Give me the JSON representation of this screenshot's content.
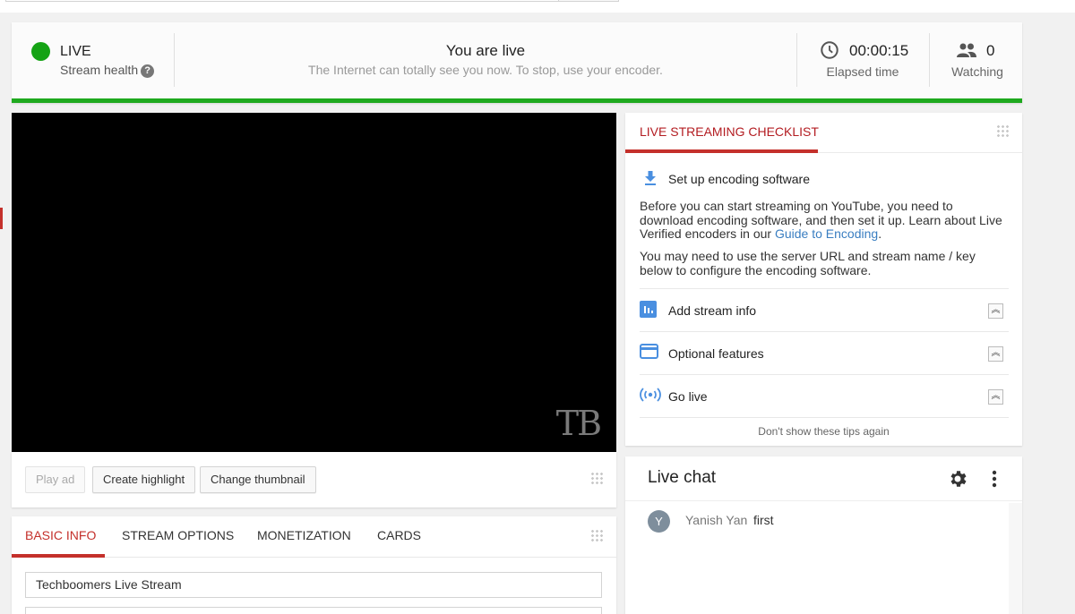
{
  "status": {
    "live_label": "LIVE",
    "health_label": "Stream health",
    "title": "You are live",
    "subtitle": "The Internet can totally see you now. To stop, use your encoder.",
    "elapsed_value": "00:00:15",
    "elapsed_label": "Elapsed time",
    "watching_value": "0",
    "watching_label": "Watching",
    "health_color": "#15a315",
    "accent_color": "#c4302b"
  },
  "video": {
    "watermark": "TB"
  },
  "actions": {
    "play_ad": "Play ad",
    "create_highlight": "Create highlight",
    "change_thumbnail": "Change thumbnail"
  },
  "info": {
    "tabs": [
      {
        "label": "BASIC INFO",
        "active": true
      },
      {
        "label": "STREAM OPTIONS",
        "active": false
      },
      {
        "label": "MONETIZATION",
        "active": false
      },
      {
        "label": "CARDS",
        "active": false
      }
    ],
    "title_value": "Techboomers Live Stream"
  },
  "checklist": {
    "title": "LIVE STREAMING CHECKLIST",
    "main_step": {
      "title": "Set up encoding software",
      "para1_text": "Before you can start streaming on YouTube, you need to download encoding software, and then set it up. Learn about Live Verified encoders in our ",
      "para1_link": "Guide to Encoding",
      "para1_end": ".",
      "para2": "You may need to use the server URL and stream name / key below to configure the encoding software."
    },
    "steps": [
      {
        "label": "Add stream info",
        "icon": "bar-chart-icon"
      },
      {
        "label": "Optional features",
        "icon": "card-icon"
      },
      {
        "label": "Go live",
        "icon": "broadcast-icon"
      }
    ],
    "dont_show": "Don't show these tips again"
  },
  "chat": {
    "title": "Live chat",
    "messages": [
      {
        "avatar_letter": "Y",
        "author": "Yanish Yan",
        "text": "first"
      }
    ]
  }
}
